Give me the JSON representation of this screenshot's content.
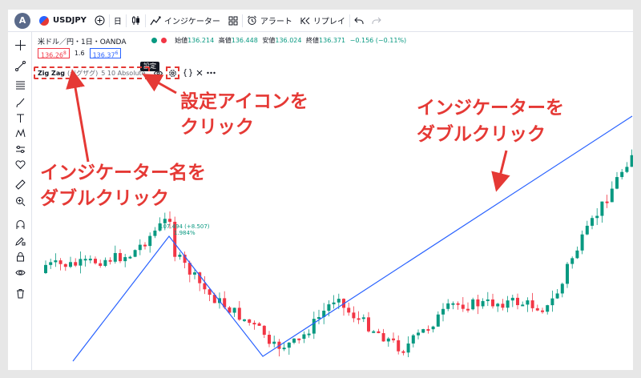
{
  "toolbar": {
    "avatar_letter": "A",
    "symbol": "USDJPY",
    "interval": "日",
    "indicators_label": "インジケーター",
    "alert_label": "アラート",
    "replay_label": "リプレイ"
  },
  "legend": {
    "title": "米ドル／円・1日・OANDA",
    "open_label": "始値",
    "open": "136.214",
    "high_label": "高値",
    "high": "136.448",
    "low_label": "安値",
    "low": "136.024",
    "close_label": "終値",
    "close": "136.371",
    "change": "−0.156 (−0.11%)",
    "sell_price": "136.26",
    "sell_sup": "8",
    "spread": "1.6",
    "buy_price": "136.37",
    "buy_sup": "6"
  },
  "indicator": {
    "name": "Zig Zag",
    "alias": "(ジグザグ)",
    "params": "5 10 Absolute",
    "tooltip": "設定"
  },
  "zigzag_label": {
    "line1": "107.494 (+8.507)",
    "line2": "1.984%"
  },
  "annotations": {
    "settings_icon_line1": "設定アイコンを",
    "settings_icon_line2": "クリック",
    "indicator_line1": "インジケーターを",
    "indicator_line2": "ダブルクリック",
    "name_line1": "インジケーター名を",
    "name_line2": "ダブルクリック"
  },
  "colors": {
    "up": "#089981",
    "down": "#f23645",
    "zigzag": "#2962ff",
    "annotation": "#e53935"
  },
  "sidebar_icons": [
    "crosshair-icon",
    "trend-line-icon",
    "fib-icon",
    "brush-icon",
    "text-icon",
    "pattern-icon",
    "forecast-icon",
    "heart-icon",
    "ruler-icon",
    "zoom-in-icon",
    "magnet-icon",
    "pencil-lock-icon",
    "lock-icon",
    "eye-icon",
    "trash-icon"
  ]
}
